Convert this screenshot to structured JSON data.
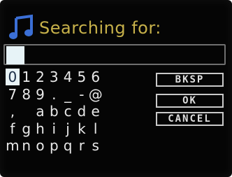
{
  "title": "Searching for:",
  "icon": "music-note-icon",
  "colors": {
    "title": "#c7b14a",
    "icon": "#3b6fd6",
    "background": "#050505",
    "selection": "#e9f3f6"
  },
  "input": {
    "value": ""
  },
  "keyboard": {
    "rows": [
      [
        "0",
        "1",
        "2",
        "3",
        "4",
        "5",
        "6"
      ],
      [
        "7",
        "8",
        "9",
        ".",
        "_",
        "-",
        "@"
      ],
      [
        ",",
        "",
        "a",
        "b",
        "c",
        "d",
        "e"
      ],
      [
        "f",
        "g",
        "h",
        "i",
        "j",
        "k",
        "l"
      ],
      [
        "m",
        "n",
        "o",
        "p",
        "q",
        "r",
        "s"
      ]
    ],
    "selected": "0"
  },
  "buttons": {
    "backspace": "BKSP",
    "ok": "OK",
    "cancel": "CANCEL"
  }
}
